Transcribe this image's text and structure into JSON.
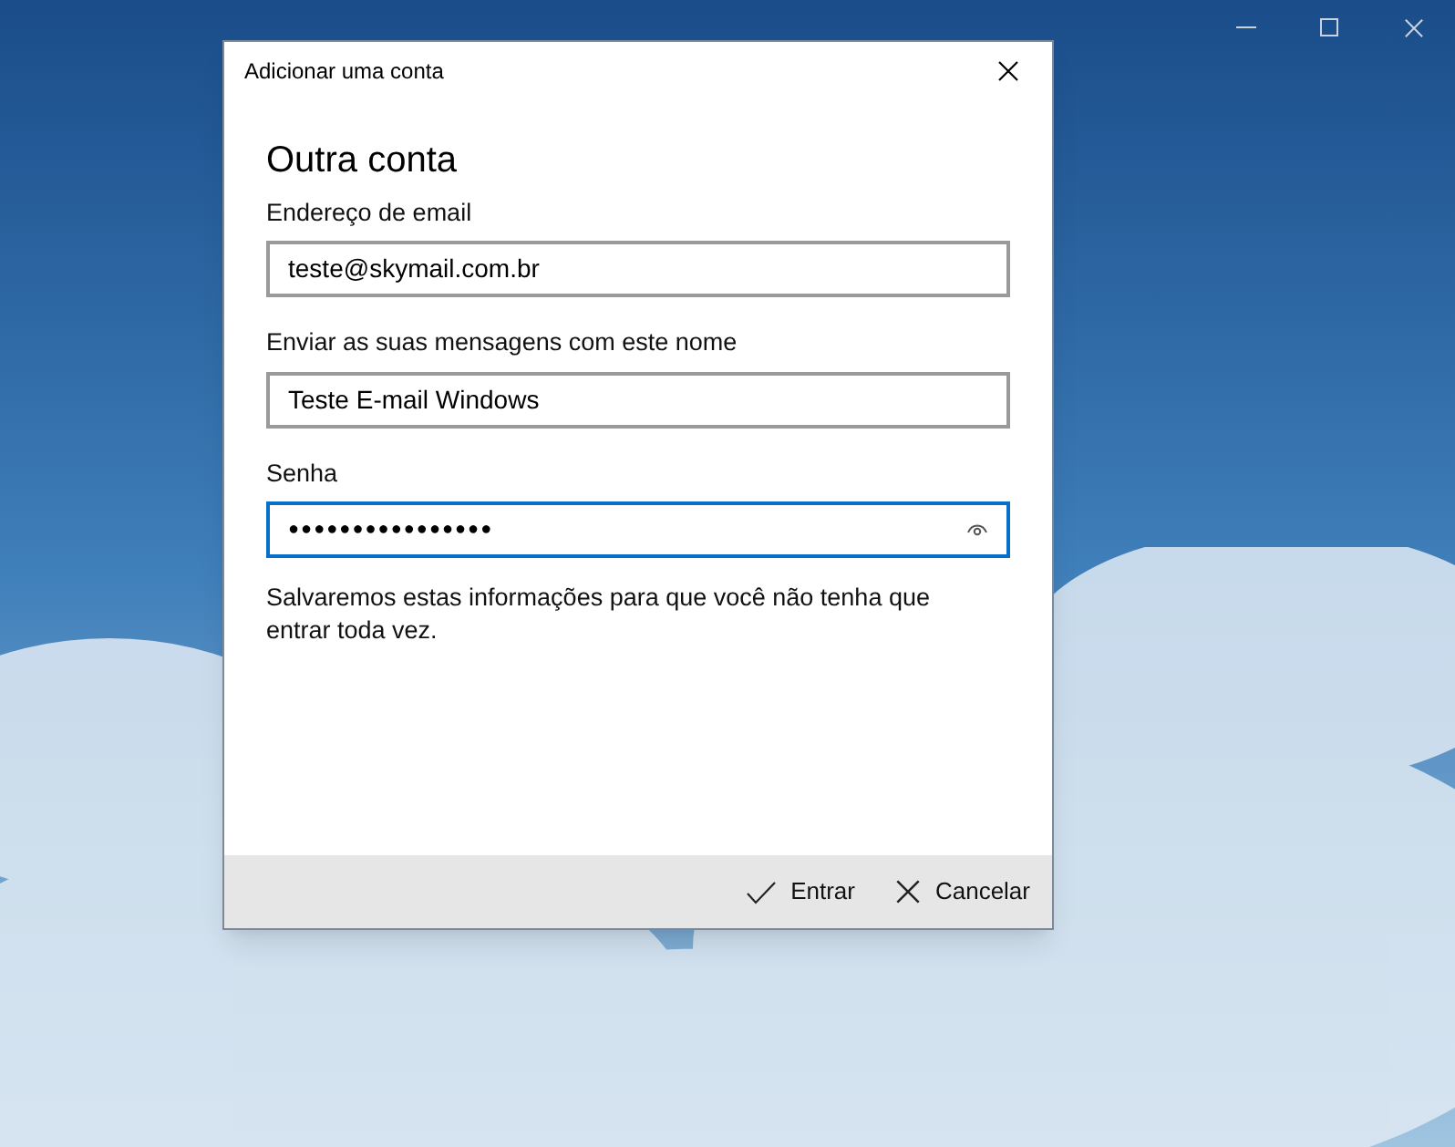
{
  "dialog": {
    "title": "Adicionar uma conta",
    "heading": "Outra conta",
    "fields": [
      {
        "label": "Endereço de email",
        "value": "teste@skymail.com.br",
        "focused": false,
        "reveal": false
      },
      {
        "label": "Enviar as suas mensagens com este nome",
        "value": "Teste E-mail Windows",
        "focused": false,
        "reveal": false
      },
      {
        "label": "Senha",
        "value": "●●●●●●●●●●●●●●●●",
        "focused": true,
        "reveal": true
      }
    ],
    "note": "Salvaremos estas informações para que você não tenha que entrar toda vez.",
    "buttons": [
      {
        "kind": "confirm",
        "label": "Entrar"
      },
      {
        "kind": "cancel",
        "label": "Cancelar"
      }
    ]
  }
}
